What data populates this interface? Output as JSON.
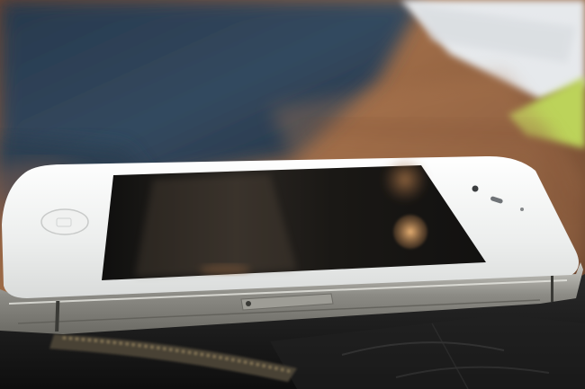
{
  "scene": {
    "subject": "white-smartphone",
    "surface": "wooden-table",
    "underlay": "black-leather-wallet",
    "background": "blurred-denim-and-paper"
  },
  "colors": {
    "denim": "#2e4258",
    "denim_dark": "#1c2a3a",
    "wood": "#8a5a3a",
    "wood_light": "#b07a52",
    "paper": "#e9ecee",
    "green_note": "#bcd35a",
    "phone_white": "#f4f5f4",
    "screen": "#141412",
    "steel_band": "#8f8e88",
    "wallet": "#1a1a1a",
    "zipper": "#5b5142"
  },
  "screen_reflections": [
    {
      "kind": "bokeh",
      "color": "#e8a868"
    },
    {
      "kind": "bokeh",
      "color": "#c78d58"
    },
    {
      "kind": "bokeh",
      "color": "#9d6a45"
    }
  ]
}
